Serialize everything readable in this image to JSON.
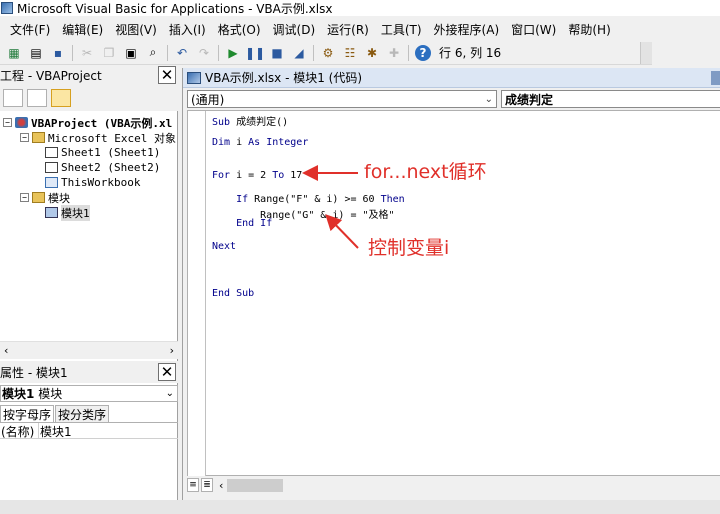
{
  "window": {
    "title": "Microsoft Visual Basic for Applications - VBA示例.xlsx"
  },
  "menu": [
    "文件(F)",
    "编辑(E)",
    "视图(V)",
    "插入(I)",
    "格式(O)",
    "调试(D)",
    "运行(R)",
    "工具(T)",
    "外接程序(A)",
    "窗口(W)",
    "帮助(H)"
  ],
  "toolbar": {
    "icons": [
      "view-excel-icon",
      "insert-module-icon",
      "save-icon",
      "cut-icon",
      "copy-icon",
      "paste-icon",
      "find-icon",
      "undo-icon",
      "redo-icon",
      "run-icon",
      "break-icon",
      "reset-icon",
      "design-mode-icon",
      "project-explorer-icon",
      "properties-icon",
      "object-browser-icon",
      "toolbox-icon",
      "help-icon"
    ],
    "status": "行 6, 列 16"
  },
  "project": {
    "title": "工程 - VBAProject",
    "tree": [
      {
        "label": "VBAProject (VBA示例.xl",
        "level": 0,
        "toggle": "−",
        "icon": "project",
        "bold": true
      },
      {
        "label": "Microsoft Excel 对象",
        "level": 1,
        "toggle": "−",
        "icon": "folder"
      },
      {
        "label": "Sheet1 (Sheet1)",
        "level": 2,
        "icon": "sheet"
      },
      {
        "label": "Sheet2 (Sheet2)",
        "level": 2,
        "icon": "sheet"
      },
      {
        "label": "ThisWorkbook",
        "level": 2,
        "icon": "workbook"
      },
      {
        "label": "模块",
        "level": 1,
        "toggle": "−",
        "icon": "folder"
      },
      {
        "label": "模块1",
        "level": 2,
        "icon": "module",
        "selected": true
      }
    ]
  },
  "properties": {
    "title": "属性 - 模块1",
    "object_name": "模块1",
    "object_type": "模块",
    "tabs": [
      "按字母序",
      "按分类序"
    ],
    "rows": [
      {
        "name": "(名称)",
        "value": "模块1"
      }
    ]
  },
  "code": {
    "title": "VBA示例.xlsx - 模块1 (代码)",
    "object_combo": "(通用)",
    "proc_combo": "成绩判定",
    "lines": [
      "Sub 成绩判定()",
      "Dim i As Integer",
      "For i = 2 To 17",
      "    If Range(\"F\" & i) >= 60 Then",
      "        Range(\"G\" & i) = \"及格\"",
      "    End If",
      "Next",
      "End Sub"
    ],
    "annotations": [
      "for...next循环",
      "控制变量i"
    ]
  },
  "colors": {
    "annotation": "#e0302a",
    "keyword": "#00008b"
  }
}
